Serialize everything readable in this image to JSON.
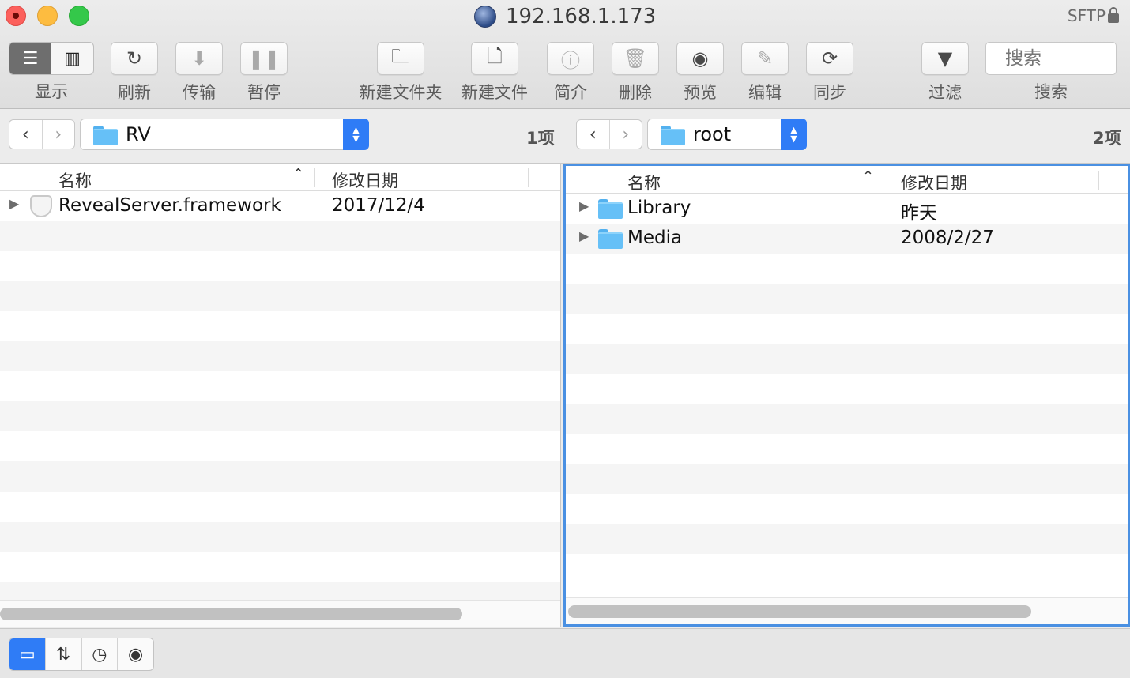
{
  "window": {
    "title": "192.168.1.173",
    "protocol": "SFTP"
  },
  "toolbar": {
    "display_label": "显示",
    "refresh_label": "刷新",
    "transfer_label": "传输",
    "pause_label": "暂停",
    "new_folder_label": "新建文件夹",
    "new_file_label": "新建文件",
    "info_label": "简介",
    "delete_label": "删除",
    "preview_label": "预览",
    "edit_label": "编辑",
    "sync_label": "同步",
    "filter_label": "过滤",
    "search_label": "搜索",
    "search_placeholder": "搜索"
  },
  "left_pane": {
    "path": "RV",
    "item_count": "1项",
    "columns": [
      "名称",
      "修改日期"
    ],
    "rows": [
      {
        "name": "RevealServer.framework",
        "date": "2017/12/4",
        "icon": "framework-icon"
      }
    ]
  },
  "right_pane": {
    "path": "root",
    "item_count": "2项",
    "columns": [
      "名称",
      "修改日期"
    ],
    "rows": [
      {
        "name": "Library",
        "date": "昨天",
        "icon": "folder-icon"
      },
      {
        "name": "Media",
        "date": "2008/2/27",
        "icon": "folder-icon"
      }
    ]
  },
  "bottom_bar": {
    "modes": [
      "dual-pane-icon",
      "transfer-arrows-icon",
      "history-clock-icon",
      "preview-eye-icon"
    ],
    "active_mode": "dual-pane-icon"
  },
  "colors": {
    "accent": "#2f7cf6",
    "focus_border": "#4a90e2",
    "folder": "#66c0f7"
  }
}
